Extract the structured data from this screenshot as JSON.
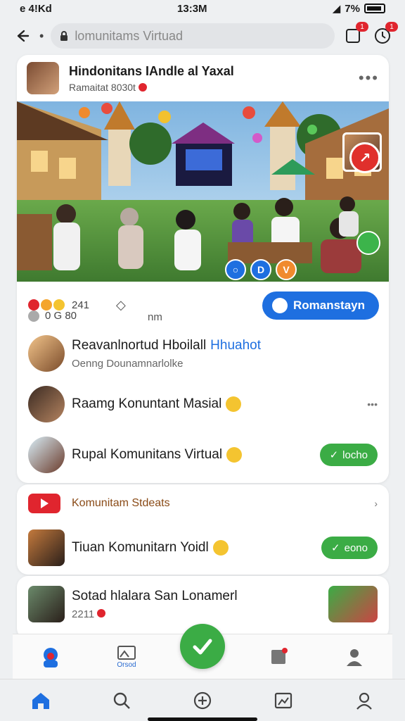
{
  "status": {
    "time_left": "e 4!Kd",
    "time_center": "13:3M",
    "signal": "◢",
    "battery": "7%"
  },
  "browser": {
    "url": "lomunitams Virtuad",
    "tab_badge": "1",
    "notif_badge": "1"
  },
  "post": {
    "title": "Hindonitans IAndle al Yaxal",
    "subtitle": "Ramaitat 8030t",
    "reaction_count": "241",
    "comment_count": "0 G 80",
    "time_ago": "nm",
    "primary_button": "Romanstayn"
  },
  "hero_badges": [
    "D",
    "V"
  ],
  "main_list": [
    {
      "title": "Reavanlnortud Hboilall",
      "accent": "Hhuahot",
      "subtitle": "Oenng Dounamnarlolke"
    },
    {
      "title": "Raamg Konuntant Masial",
      "subtitle": ""
    },
    {
      "title": "Rupal Komunitans Virtual",
      "subtitle": "",
      "button": "locho"
    }
  ],
  "events": {
    "title": "Komunitam Stdeats",
    "items": [
      {
        "title": "Tiuan Komunitarn Yoidl",
        "button": "eono"
      }
    ]
  },
  "third": {
    "title": "Sotad hlalara San Lonamerl",
    "count": "2211"
  },
  "shelf": {
    "label_two": "Orsod"
  },
  "colors": {
    "accent_blue": "#1e6fe0",
    "green": "#3bac45",
    "red": "#e0252e",
    "brown": "#8a4b17"
  },
  "icons": [
    "back-arrow-icon",
    "lock-icon",
    "tabs-icon",
    "history-icon",
    "more-icon",
    "home-icon",
    "search-icon",
    "add-icon",
    "gallery-icon",
    "profile-icon"
  ]
}
